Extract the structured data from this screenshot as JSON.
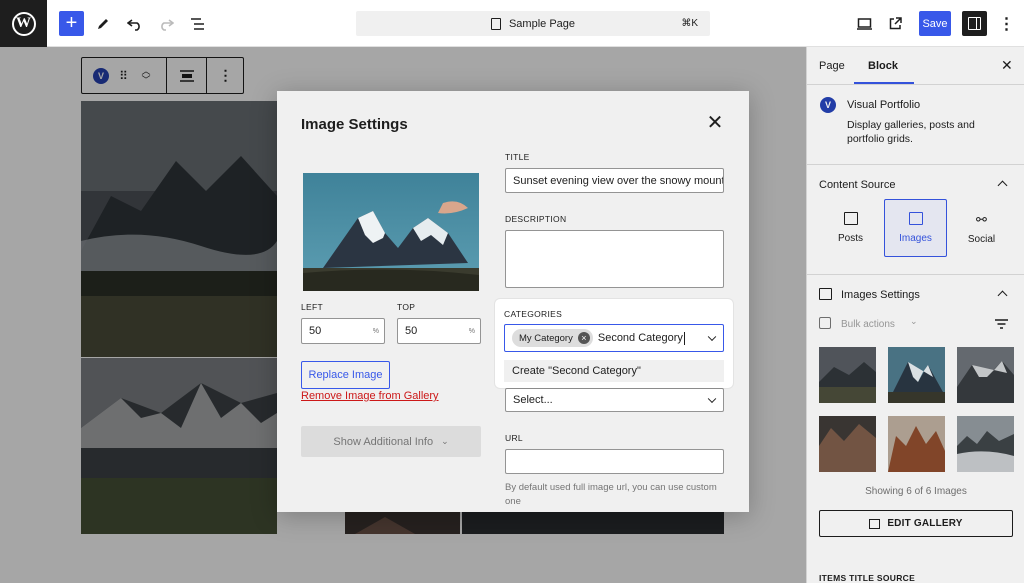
{
  "topbar": {
    "doc_title": "Sample Page",
    "shortcut": "⌘K",
    "save_label": "Save",
    "icons": [
      "wordpress-logo",
      "plus-icon",
      "pen-icon",
      "undo-icon",
      "redo-icon",
      "list-view-icon",
      "desktop-preview-icon",
      "external-link-icon",
      "sidebar-icon",
      "more-vertical-icon"
    ]
  },
  "block_toolbar": {
    "badge": "V",
    "icons": [
      "drag-handle-icon",
      "move-up-icon",
      "move-down-icon",
      "align-icon",
      "more-vertical-icon"
    ]
  },
  "modal": {
    "title": "Image Settings",
    "left_label": "LEFT",
    "left_value": "50",
    "top_label": "TOP",
    "top_value": "50",
    "unit": "%",
    "replace_label": "Replace Image",
    "remove_label": "Remove Image from Gallery",
    "additional_label": "Show Additional Info",
    "title_label": "TITLE",
    "title_value": "Sunset evening view over the snowy mount",
    "description_label": "DESCRIPTION",
    "description_value": "",
    "categories_label": "CATEGORIES",
    "category_chip": "My Category",
    "category_typed": "Second Category",
    "create_option": "Create \"Second Category\"",
    "select_placeholder": "Select...",
    "url_label": "URL",
    "url_value": "",
    "url_help": "By default used full image url, you can use custom one"
  },
  "sidebar": {
    "tabs": [
      {
        "label": "Page",
        "active": false
      },
      {
        "label": "Block",
        "active": true
      }
    ],
    "plugin_name": "Visual Portfolio",
    "plugin_desc": "Display galleries, posts and portfolio grids.",
    "content_source_title": "Content Source",
    "sources": [
      {
        "label": "Posts",
        "active": false
      },
      {
        "label": "Images",
        "active": true
      },
      {
        "label": "Social",
        "active": false
      }
    ],
    "images_settings_title": "Images Settings",
    "bulk_actions": "Bulk actions",
    "showing_text": "Showing 6 of 6 Images",
    "edit_gallery": "EDIT GALLERY",
    "items_title_source": "ITEMS TITLE SOURCE"
  },
  "colors": {
    "accent": "#3858e9",
    "danger": "#cc1818",
    "dark": "#1e1e1e"
  }
}
